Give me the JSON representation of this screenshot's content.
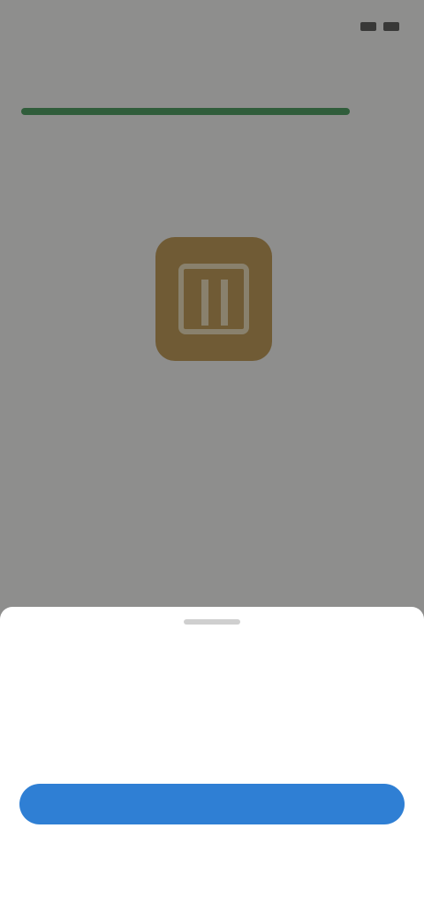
{
  "status_bar": {
    "time": "",
    "icons": [
      "signal-icon",
      "battery-icon"
    ]
  },
  "header": {
    "progress_percent": 78
  },
  "tabs": [
    {
      "label": ""
    },
    {
      "label": ""
    },
    {
      "label": ""
    },
    {
      "label": ""
    },
    {
      "label": ""
    }
  ],
  "product": {
    "icon": "app-icon",
    "description": "",
    "price": "",
    "list_item": ""
  },
  "sheet": {
    "title": "",
    "text": "",
    "link": "",
    "primary_button": "",
    "secondary_button": ""
  },
  "colors": {
    "accent": "#2f7fd4",
    "progress": "#1f8a3c",
    "app_icon": "#b8862e",
    "active_tab": "#c0902a"
  }
}
